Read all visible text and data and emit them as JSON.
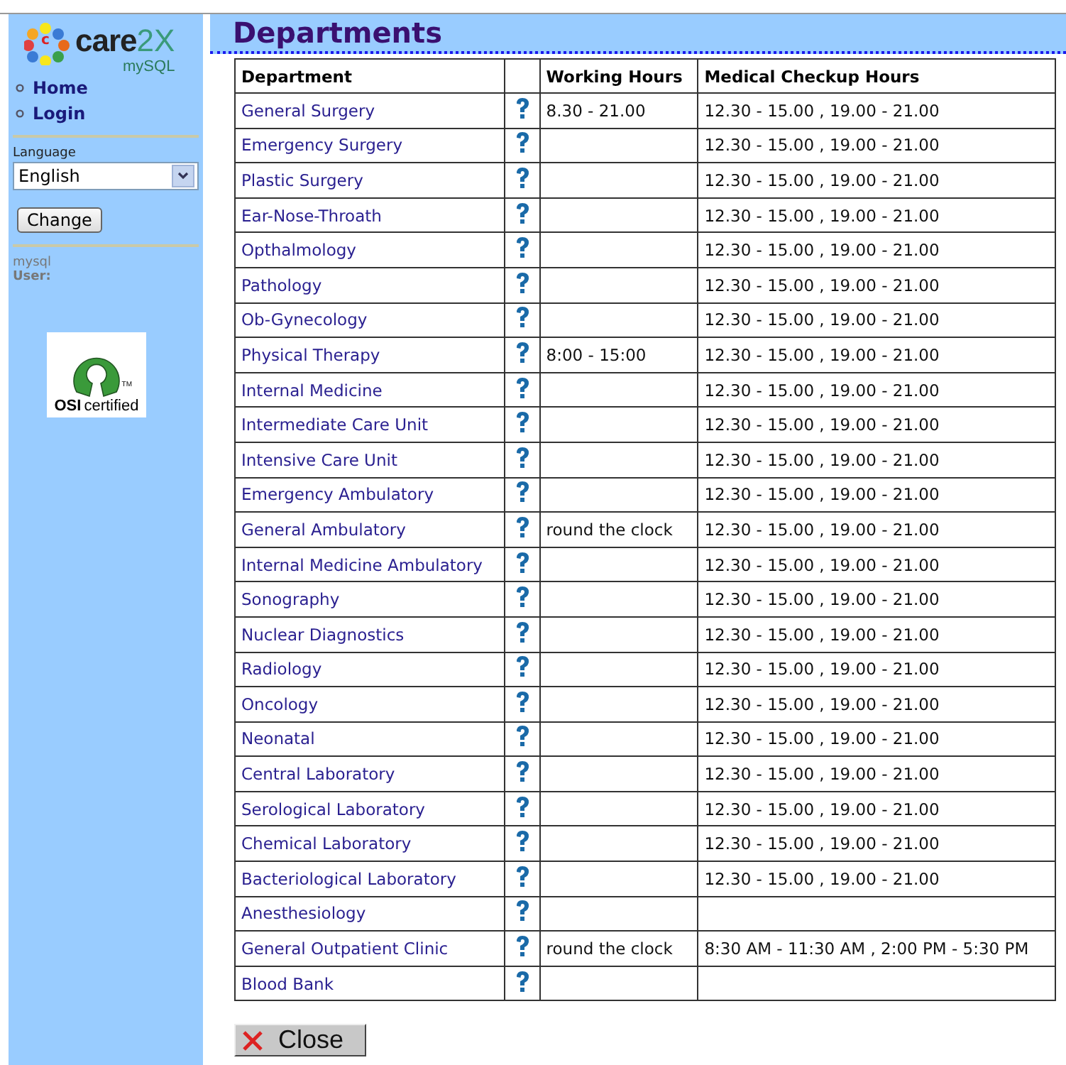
{
  "sidebar": {
    "logo": {
      "mark": "c",
      "name": "care",
      "suffix": "2X",
      "sub": "mySQL"
    },
    "nav": [
      {
        "label": "Home"
      },
      {
        "label": "Login"
      }
    ],
    "language": {
      "label": "Language",
      "value": "English"
    },
    "change_button": "Change",
    "db": "mysql",
    "user_label": "User:",
    "badge": {
      "brand": "OSI",
      "text": "certified",
      "tm": "TM"
    }
  },
  "title": "Departments",
  "table": {
    "columns": [
      "Department",
      "",
      "Working Hours",
      "Medical Checkup Hours"
    ],
    "rows": [
      {
        "name": "General Surgery",
        "working": "8.30 - 21.00",
        "checkup": "12.30 - 15.00 , 19.00 - 21.00"
      },
      {
        "name": "Emergency Surgery",
        "working": "",
        "checkup": "12.30 - 15.00 , 19.00 - 21.00"
      },
      {
        "name": "Plastic Surgery",
        "working": "",
        "checkup": "12.30 - 15.00 , 19.00 - 21.00"
      },
      {
        "name": "Ear-Nose-Throath",
        "working": "",
        "checkup": "12.30 - 15.00 , 19.00 - 21.00"
      },
      {
        "name": "Opthalmology",
        "working": "",
        "checkup": "12.30 - 15.00 , 19.00 - 21.00"
      },
      {
        "name": "Pathology",
        "working": "",
        "checkup": "12.30 - 15.00 , 19.00 - 21.00"
      },
      {
        "name": "Ob-Gynecology",
        "working": "",
        "checkup": "12.30 - 15.00 , 19.00 - 21.00"
      },
      {
        "name": "Physical Therapy",
        "working": "8:00 - 15:00",
        "checkup": "12.30 - 15.00 , 19.00 - 21.00"
      },
      {
        "name": "Internal Medicine",
        "working": "",
        "checkup": "12.30 - 15.00 , 19.00 - 21.00"
      },
      {
        "name": "Intermediate Care Unit",
        "working": "",
        "checkup": "12.30 - 15.00 , 19.00 - 21.00"
      },
      {
        "name": "Intensive Care Unit",
        "working": "",
        "checkup": "12.30 - 15.00 , 19.00 - 21.00"
      },
      {
        "name": "Emergency Ambulatory",
        "working": "",
        "checkup": "12.30 - 15.00 , 19.00 - 21.00"
      },
      {
        "name": "General Ambulatory",
        "working": "round the clock",
        "checkup": "12.30 - 15.00 , 19.00 - 21.00"
      },
      {
        "name": "Internal Medicine Ambulatory",
        "working": "",
        "checkup": "12.30 - 15.00 , 19.00 - 21.00"
      },
      {
        "name": "Sonography",
        "working": "",
        "checkup": "12.30 - 15.00 , 19.00 - 21.00"
      },
      {
        "name": "Nuclear Diagnostics",
        "working": "",
        "checkup": "12.30 - 15.00 , 19.00 - 21.00"
      },
      {
        "name": "Radiology",
        "working": "",
        "checkup": "12.30 - 15.00 , 19.00 - 21.00"
      },
      {
        "name": "Oncology",
        "working": "",
        "checkup": "12.30 - 15.00 , 19.00 - 21.00"
      },
      {
        "name": "Neonatal",
        "working": "",
        "checkup": "12.30 - 15.00 , 19.00 - 21.00"
      },
      {
        "name": "Central Laboratory",
        "working": "",
        "checkup": "12.30 - 15.00 , 19.00 - 21.00"
      },
      {
        "name": "Serological Laboratory",
        "working": "",
        "checkup": "12.30 - 15.00 , 19.00 - 21.00"
      },
      {
        "name": "Chemical Laboratory",
        "working": "",
        "checkup": "12.30 - 15.00 , 19.00 - 21.00"
      },
      {
        "name": "Bacteriological Laboratory",
        "working": "",
        "checkup": "12.30 - 15.00 , 19.00 - 21.00"
      },
      {
        "name": "Anesthesiology",
        "working": "",
        "checkup": ""
      },
      {
        "name": "General Outpatient Clinic",
        "working": "round the clock",
        "checkup": "8:30 AM - 11:30 AM , 2:00 PM - 5:30 PM"
      },
      {
        "name": "Blood Bank",
        "working": "",
        "checkup": ""
      }
    ]
  },
  "close_button": "Close"
}
